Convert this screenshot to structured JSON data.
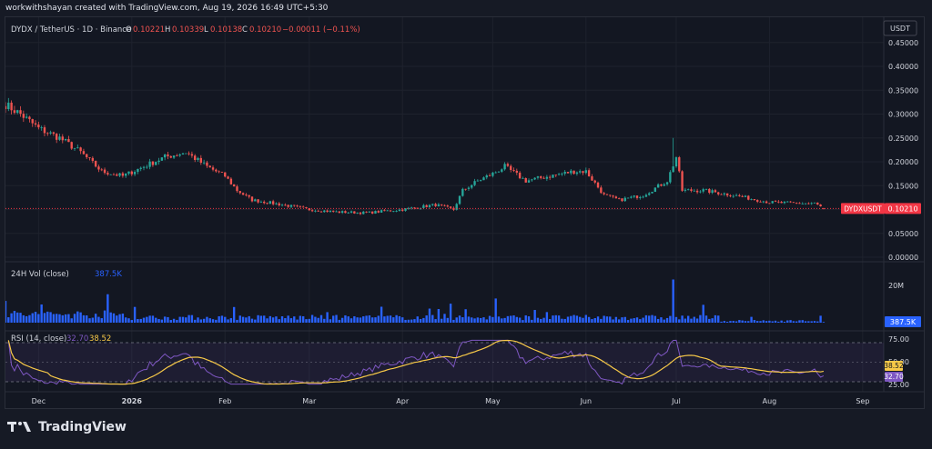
{
  "attribution": "workwithshayan created with TradingView.com, Aug 19, 2026 16:49 UTC+5:30",
  "brand": "TradingView",
  "colors": {
    "up": "#26a69a",
    "down": "#ef5350",
    "volume": "#2962ff",
    "rsi": "#7e57c2",
    "rsi_ma": "#f7c948",
    "price_tag": "#f23645",
    "currency_box": "#131722"
  },
  "icons": {
    "logo": "tradingview-logo"
  },
  "header": {
    "symbol": "DYDX / TetherUS · 1D · Binance",
    "o_label": "O",
    "o_value": "0.10221",
    "h_label": "H",
    "h_value": "0.10339",
    "l_label": "L",
    "l_value": "0.10138",
    "c_label": "C",
    "c_value": "0.10210",
    "change": "−0.00011 (−0.11%)"
  },
  "currency": "USDT",
  "price_tag": {
    "symbol": "DYDXUSDT",
    "value": "0.10210"
  },
  "volume_pane": {
    "label": "24H Vol (close)",
    "value": "387.5K",
    "axis_label": "20M",
    "tag": "387.5K"
  },
  "rsi_pane": {
    "label": "RSI (14, close)",
    "rsi_value": "32.70",
    "ma_value": "38.52",
    "axis": [
      "75.00",
      "50.00",
      "25.00"
    ],
    "tag_ma": "38.52",
    "tag_rsi": "32.70"
  },
  "chart_data": [
    {
      "type": "candlestick",
      "title": "DYDX / TetherUS · 1D · Binance",
      "ylim": [
        0,
        0.48
      ],
      "yticks": [
        "0.45000",
        "0.40000",
        "0.35000",
        "0.30000",
        "0.25000",
        "0.20000",
        "0.15000",
        "0.10000",
        "0.05000",
        "0.00000"
      ],
      "x_ticks": [
        "Dec",
        "2026",
        "Feb",
        "Mar",
        "Apr",
        "May",
        "Jun",
        "Jul",
        "Aug",
        "Sep"
      ],
      "x_tick_dates": [
        "2025-12-01",
        "2026-01-01",
        "2026-02-01",
        "2026-03-01",
        "2026-04-01",
        "2026-05-01",
        "2026-06-01",
        "2026-07-01",
        "2026-08-01",
        "2026-09-01"
      ],
      "x_range": [
        "2025-11-20",
        "2026-09-08"
      ],
      "path_dates": [
        "2025-11-20",
        "2025-11-25",
        "2025-12-01",
        "2025-12-08",
        "2025-12-15",
        "2025-12-22",
        "2025-12-29",
        "2026-01-05",
        "2026-01-12",
        "2026-01-19",
        "2026-01-26",
        "2026-02-01",
        "2026-02-05",
        "2026-02-10",
        "2026-02-20",
        "2026-03-01",
        "2026-03-10",
        "2026-03-20",
        "2026-04-01",
        "2026-04-12",
        "2026-04-18",
        "2026-04-21",
        "2026-04-26",
        "2026-05-01",
        "2026-05-05",
        "2026-05-12",
        "2026-05-20",
        "2026-05-28",
        "2026-06-01",
        "2026-06-07",
        "2026-06-12",
        "2026-06-20",
        "2026-06-28",
        "2026-07-01",
        "2026-07-03",
        "2026-07-10",
        "2026-07-20",
        "2026-08-01",
        "2026-08-10",
        "2026-08-16",
        "2026-08-19"
      ],
      "path_closes": [
        0.32,
        0.3,
        0.27,
        0.25,
        0.22,
        0.18,
        0.17,
        0.19,
        0.21,
        0.22,
        0.19,
        0.17,
        0.14,
        0.12,
        0.11,
        0.1,
        0.095,
        0.093,
        0.1,
        0.11,
        0.1,
        0.14,
        0.16,
        0.175,
        0.19,
        0.16,
        0.17,
        0.18,
        0.18,
        0.13,
        0.12,
        0.13,
        0.16,
        0.21,
        0.14,
        0.14,
        0.13,
        0.115,
        0.113,
        0.113,
        0.1021
      ],
      "last": {
        "date": "2026-08-19",
        "open": 0.10221,
        "high": 0.10339,
        "low": 0.10138,
        "close": 0.1021
      },
      "spike": {
        "date": "2026-06-30",
        "high": 0.25
      }
    },
    {
      "type": "bar",
      "title": "24H Vol (close)",
      "last_value": 387500,
      "axis_tick": "20M",
      "spikes": [
        {
          "date": "2026-06-30",
          "value": 25000000
        },
        {
          "date": "2026-05-02",
          "value": 14000000
        },
        {
          "date": "2026-04-17",
          "value": 11000000
        }
      ]
    },
    {
      "type": "line",
      "title": "RSI (14, close)",
      "ylim": [
        20,
        80
      ],
      "levels": [
        75,
        50,
        25
      ],
      "series": [
        {
          "name": "RSI",
          "last": 32.7
        },
        {
          "name": "RSI-based MA",
          "last": 38.52
        }
      ]
    }
  ]
}
